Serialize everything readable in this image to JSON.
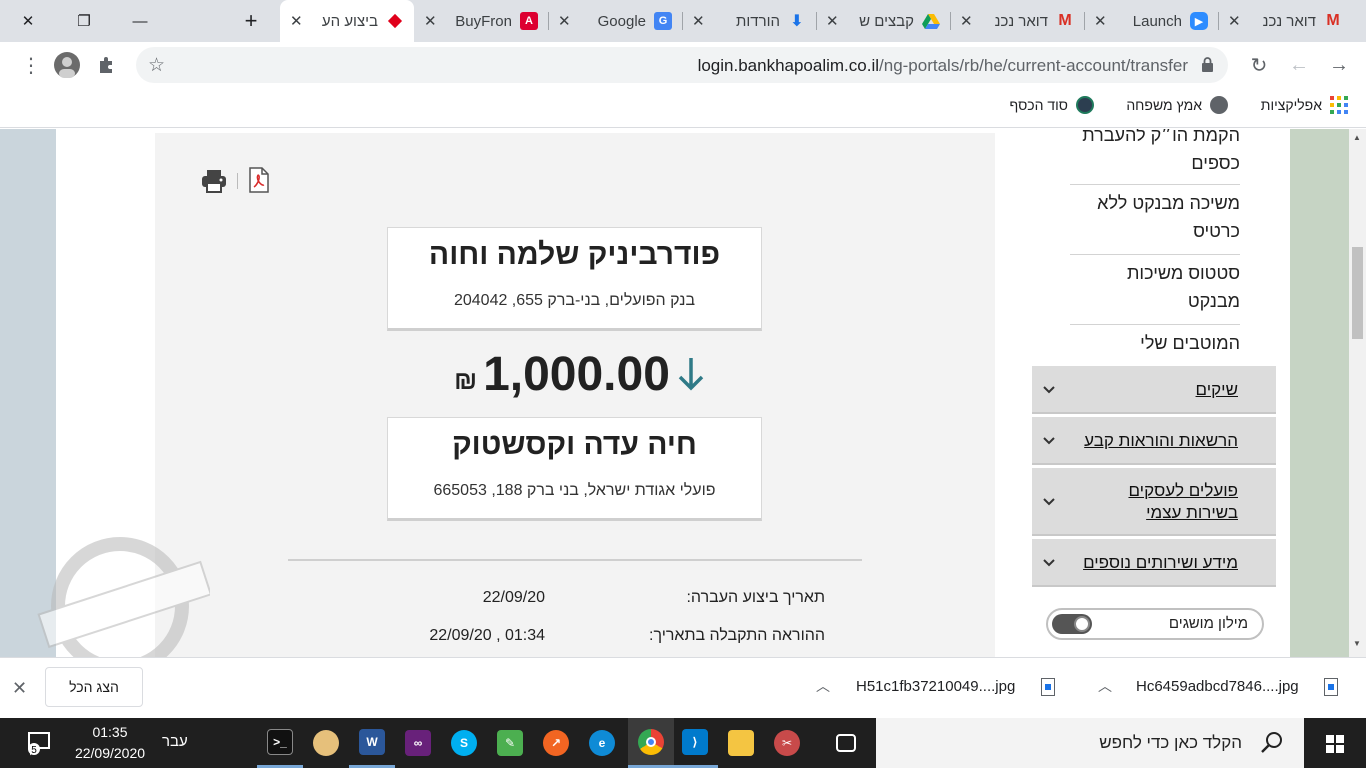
{
  "browser": {
    "tabs": [
      {
        "title": "ביצוע הע",
        "favicon": "red-diamond-icon",
        "active": true
      },
      {
        "title": "BuyFron",
        "favicon": "angular-icon"
      },
      {
        "title": "Google",
        "favicon": "google-translate-icon"
      },
      {
        "title": "הורדות",
        "favicon": "download-icon"
      },
      {
        "title": "קבצים ש",
        "favicon": "google-drive-icon"
      },
      {
        "title": "דואר נכנ",
        "favicon": "gmail-icon"
      },
      {
        "title": "Launch",
        "favicon": "zoom-icon"
      },
      {
        "title": "דואר נכנ",
        "favicon": "gmail-icon"
      }
    ],
    "url_host": "login.bankhapoalim.co.il",
    "url_path": "/ng-portals/rb/he/current-account/transfer",
    "bookmarks": [
      {
        "label": "אפליקציות",
        "icon": "apps-grid-icon"
      },
      {
        "label": "אמץ משפחה",
        "icon": "globe-icon"
      },
      {
        "label": "סוד הכסף",
        "icon": "bulb-icon"
      }
    ]
  },
  "transfer": {
    "from_name": "פודרביניק שלמה וחוה",
    "from_bank": "בנק הפועלים, בני-ברק 655, 204042",
    "amount": "1,000.00",
    "currency": "₪",
    "to_name": "חיה עדה וקסשטוק",
    "to_bank": "פועלי אגודת ישראל, בני ברק 188, 665053",
    "details": [
      {
        "label": "תאריך ביצוע העברה:",
        "value": "22/09/20"
      },
      {
        "label": "ההוראה התקבלה בתאריך:",
        "value": "22/09/20 , 01:34"
      }
    ]
  },
  "side_nav": {
    "links": [
      "הקמת הו״ק להעברת כספים",
      "משיכה מבנקט ללא כרטיס",
      "סטטוס משיכות מבנקט",
      "המוטבים שלי"
    ],
    "accordions": [
      "שיקים",
      "הרשאות והוראות קבע",
      "פועלים לעסקים בשירות עצמי",
      "מידע ושירותים נוספים"
    ],
    "toggle_label": "מילון מושגים"
  },
  "downloads": {
    "show_all": "הצג הכל",
    "files": [
      "H51c1fb37210049....jpg",
      "Hc6459adbcd7846....jpg"
    ]
  },
  "taskbar": {
    "search_placeholder": "הקלד כאן כדי לחפש",
    "language": "עבר",
    "time": "01:35",
    "date": "22/09/2020",
    "notifications": "5"
  },
  "colors": {
    "accent_teal": "#2f7a87",
    "gmail_red": "#d93025",
    "taskbar": "#1f1f1f"
  }
}
